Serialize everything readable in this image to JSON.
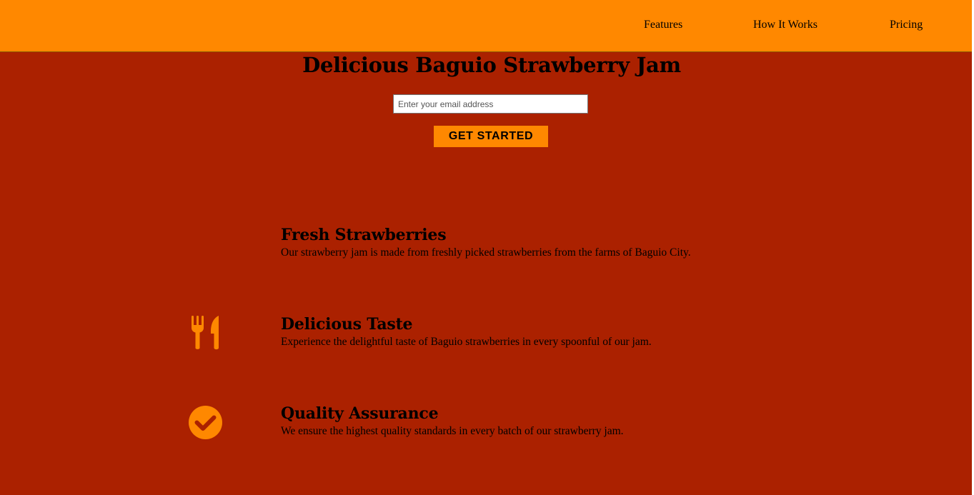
{
  "nav": {
    "links": [
      "Features",
      "How It Works",
      "Pricing"
    ]
  },
  "hero": {
    "title": "Delicious Baguio Strawberry Jam",
    "email_placeholder": "Enter your email address",
    "cta_label": "GET STARTED"
  },
  "features": [
    {
      "title": "Fresh Strawberries",
      "description": "Our strawberry jam is made from freshly picked strawberries from the farms of Baguio City.",
      "icon": "none"
    },
    {
      "title": "Delicious Taste",
      "description": "Experience the delightful taste of Baguio strawberries in every spoonful of our jam.",
      "icon": "utensils-icon"
    },
    {
      "title": "Quality Assurance",
      "description": "We ensure the highest quality standards in every batch of our strawberry jam.",
      "icon": "check-circle-icon"
    }
  ],
  "colors": {
    "background": "#ab2100",
    "accent": "#ff8800"
  }
}
